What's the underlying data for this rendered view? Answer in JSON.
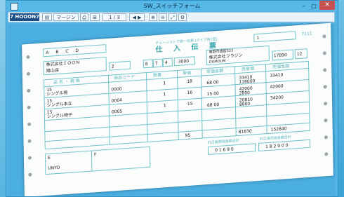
{
  "window": {
    "title": "SW_スイッチフォーム",
    "minimize": "–",
    "restore": "□",
    "close": "✕"
  },
  "toolbar": {
    "brand": "7 HOOON7",
    "margin": "マージン",
    "page": "1 / 3",
    "nav": "◀ ▶"
  },
  "form": {
    "header_fields": [
      "A",
      "B",
      "C",
      "D"
    ],
    "subtitle": "チェーンストア統一伝票 (タイプ用1型)",
    "title": "仕 入 伝 票",
    "customer_company": "株式会社ＩＯＯＮ",
    "customer_branch": "陽山店",
    "slip_no": "2",
    "dept": "8",
    "code1": "7",
    "code2": "4",
    "code3": "3000",
    "supplier_code": "1",
    "supplier_address": "東野市銀座033",
    "supplier_name": "株式会社フラジン",
    "supplier_tel": "DUMDUM",
    "slip_code": "17890",
    "slip_code2": "12",
    "col_headers": [
      "品 名 ・ 規 格",
      "商品コード",
      "数量",
      "単価",
      "原価金額",
      "売単価",
      "売価金額"
    ],
    "rows": [
      {
        "no": "15",
        "name": "シングル椅",
        "code": "0000",
        "qty": "1",
        "unit": "18",
        "cost": "68 00",
        "price": "33410",
        "cost_amount": "118000",
        "sale": "33410"
      },
      {
        "no": "15",
        "name": "シングル本立",
        "code": "0004",
        "qty": "1",
        "unit": "16",
        "cost": "15 00",
        "price": "42000",
        "cost_amount": "2800",
        "sale": "42000"
      },
      {
        "no": "15",
        "name": "シングル椅子",
        "code": "0005",
        "qty": "1",
        "unit": "15",
        "cost": "68 00",
        "price": "20810",
        "cost_amount": "8800",
        "sale": "34200"
      }
    ],
    "total_qty": "95",
    "total_cost": "81830",
    "total_sale": "152840",
    "footer_left": [
      "E",
      "F",
      "UNYO"
    ],
    "footer_right_label1": "訂正後原価金額合計",
    "footer_right_label2": "訂正後売価金額合計",
    "footer_right_value1": "0 1 6 9 0",
    "footer_right_value2": "1 8 2 9 0 0",
    "right_margin_no": "7111"
  }
}
